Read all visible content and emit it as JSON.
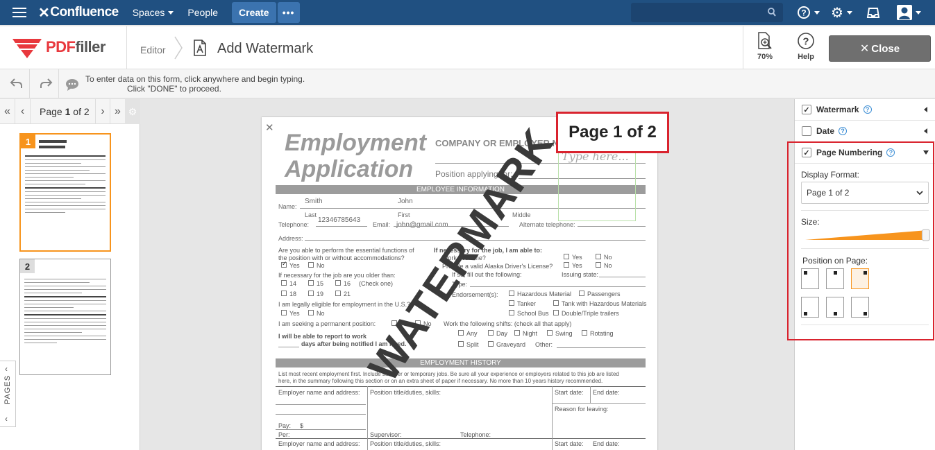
{
  "confluence": {
    "logo": "Confluence",
    "spaces": "Spaces",
    "people": "People",
    "create": "Create",
    "more": "•••"
  },
  "pdffiller": {
    "logo_pdf": "PDF",
    "logo_filler": "filler",
    "breadcrumb_editor": "Editor",
    "page_title": "Add Watermark",
    "zoom": "70%",
    "help": "Help",
    "close": "Close"
  },
  "toolbar": {
    "hint_line1": "To enter data on this form, click anywhere and begin typing.",
    "hint_line2": "Click \"DONE\" to proceed."
  },
  "pager": {
    "label_prefix": "Page",
    "current": "1",
    "label_mid": "of",
    "total": "2",
    "pages_tab": "PAGES",
    "thumbs": [
      "1",
      "2"
    ]
  },
  "document": {
    "title_line1": "Employment",
    "title_line2": "Application",
    "company": "COMPANY OR EMPLOYER NAME",
    "position_applying": "Position applying for:",
    "page_number_stamp": "Page 1 of 2",
    "sign_placeholder": "Type here...",
    "watermark": "WATERMARK",
    "band_employee": "EMPLOYEE INFORMATION",
    "band_history": "EMPLOYMENT HISTORY",
    "name_label": "Name:",
    "last_name": "Smith",
    "first_name": "John",
    "last_label": "Last",
    "first_label": "First",
    "middle_label": "Middle",
    "telephone_label": "Telephone:",
    "telephone_value": "12346785643",
    "email_label": "Email:",
    "email_value": "john@gmail.com",
    "alt_tel_label": "Alternate telephone:",
    "address_label": "Address:",
    "q_functions": "Are you able to perform the essential functions of",
    "q_functions2": "the position with or without accommodations?",
    "yes": "Yes",
    "no": "No",
    "q_older": "If necessary for the job are you older than:",
    "ages": [
      "14",
      "15",
      "16",
      "18",
      "19",
      "21"
    ],
    "check_one": "(Check one)",
    "q_eligible": "I am legally eligible for employment in the U.S.?",
    "q_permanent": "I am seeking a permanent position:",
    "report_line1": "I will be able to report to work",
    "report_line2": "days after being notified I am hired.",
    "if_necessary": "If necessary for the job, I am able to:",
    "work_overtime": "Work overtime?",
    "valid_license": "Provide a valid Alaska Driver's License?",
    "if_so": "If so, fill out the following:",
    "issuing_state": "Issuing state:",
    "type_label": "Type:",
    "endorsements": "Endorsement(s):",
    "hazmat": "Hazardous Material",
    "passengers": "Passengers",
    "tanker": "Tanker",
    "tank_hazmat": "Tank with Hazardous Materials",
    "school_bus": "School Bus",
    "double_triple": "Double/Triple trailers",
    "shifts_label": "Work the following shifts: (check all that apply)",
    "any": "Any",
    "day": "Day",
    "night": "Night",
    "swing": "Swing",
    "rotating": "Rotating",
    "split": "Split",
    "graveyard": "Graveyard",
    "other": "Other:",
    "history_text1": "List most recent employment first. Include summer or temporary jobs. Be sure all your experience or employers related to this job are listed",
    "history_text2": "here, in the summary following this section or on an extra sheet of paper if necessary. No more than 10 years history recommended.",
    "employer_label": "Employer name and address:",
    "position_label": "Position title/duties, skills:",
    "start_label": "Start date:",
    "end_label": "End date:",
    "reason_label": "Reason for leaving:",
    "pay_label": "Pay:",
    "dollar": "$",
    "per_label": "Per:",
    "supervisor_label": "Supervisor:",
    "telephone2_label": "Telephone:"
  },
  "right_panel": {
    "watermark": "Watermark",
    "date": "Date",
    "page_numbering": "Page Numbering",
    "display_format_label": "Display Format:",
    "display_format_value": "Page 1 of 2",
    "size_label": "Size:",
    "size_level": 0.98,
    "position_label": "Position on Page:",
    "selected_position": "top-right"
  },
  "colors": {
    "confluence_blue": "#205081",
    "pdffiller_red": "#e8383d",
    "highlight_red": "#d9232e",
    "accent_orange": "#f7941d"
  }
}
